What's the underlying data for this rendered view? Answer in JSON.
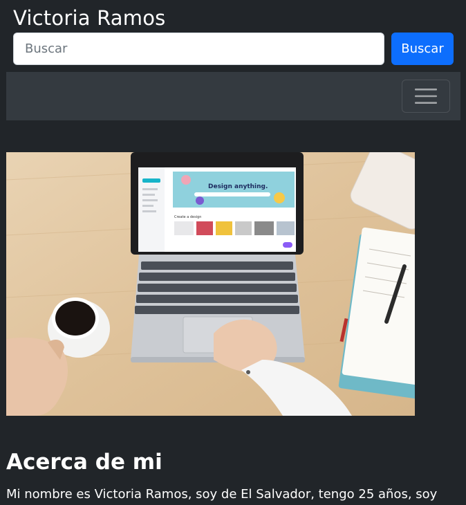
{
  "header": {
    "brand": "Victoria Ramos",
    "search_placeholder": "Buscar",
    "search_button": "Buscar"
  },
  "navbar": {
    "toggler_icon": "hamburger-menu-icon"
  },
  "hero_image": {
    "screen_headline": "Design anything.",
    "sidebar_heading": "Create a design"
  },
  "about": {
    "title": "Acerca de mi",
    "text": "Mi nombre es Victoria Ramos, soy de El Salvador, tengo 25 años, soy"
  },
  "colors": {
    "page_bg": "#212529",
    "navbar_bg": "#343a40",
    "primary": "#0d6efd"
  }
}
